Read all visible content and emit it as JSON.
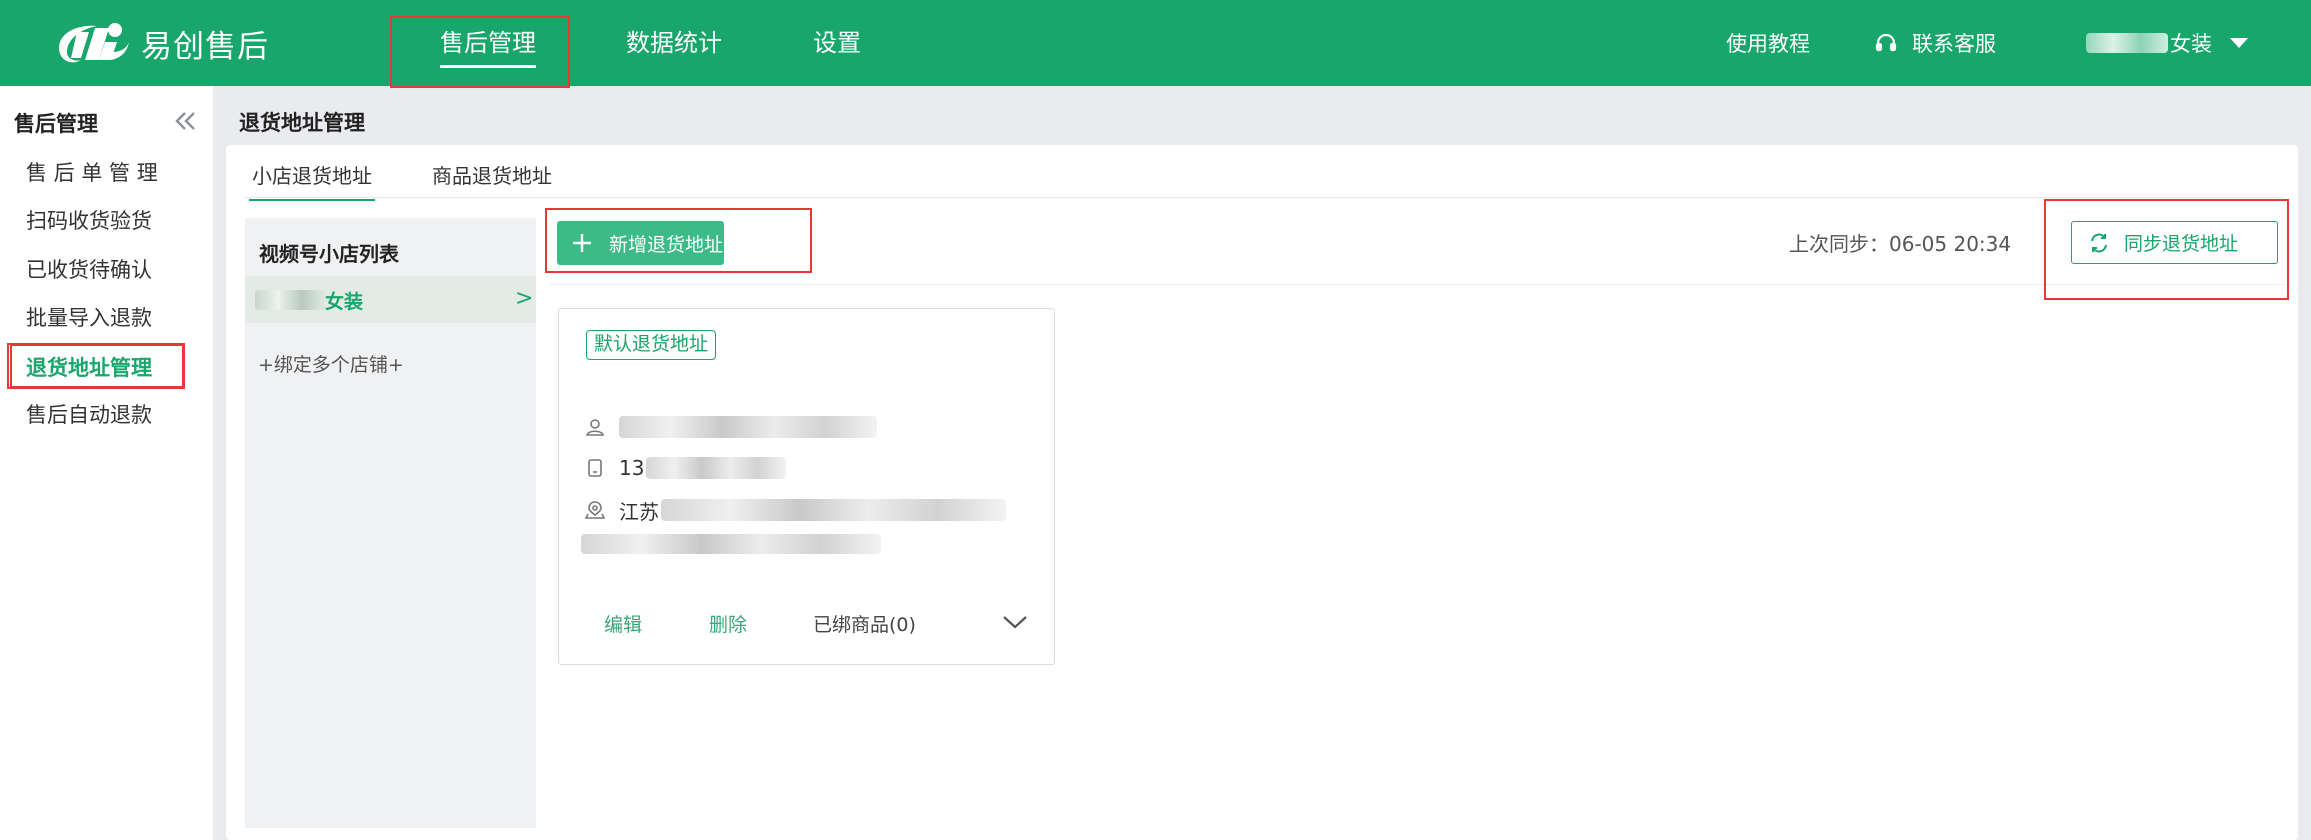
{
  "header": {
    "app_name": "易创售后",
    "nav": [
      {
        "label": "售后管理",
        "active": true
      },
      {
        "label": "数据统计",
        "active": false
      },
      {
        "label": "设置",
        "active": false
      }
    ],
    "tutorial_label": "使用教程",
    "support_label": "联系客服",
    "user_suffix": "女装",
    "brand_color": "#18a66b"
  },
  "sidebar": {
    "title": "售后管理",
    "items": [
      {
        "label": "售 后 单 管 理",
        "active": false
      },
      {
        "label": "扫码收货验货",
        "active": false
      },
      {
        "label": "已收货待确认",
        "active": false
      },
      {
        "label": "批量导入退款",
        "active": false
      },
      {
        "label": "退货地址管理",
        "active": true
      },
      {
        "label": "售后自动退款",
        "active": false
      }
    ]
  },
  "main": {
    "page_title": "退货地址管理",
    "tabs": [
      {
        "label": "小店退货地址",
        "active": true
      },
      {
        "label": "商品退货地址",
        "active": false
      }
    ],
    "shop_list": {
      "title": "视频号小店列表",
      "shops": [
        {
          "name_suffix": "女装",
          "selected": true
        }
      ],
      "bind_more_label": "+绑定多个店铺+"
    },
    "add_button_label": "新增退货地址",
    "last_sync_label": "上次同步：06-05 20:34",
    "sync_button_label": "同步退货地址",
    "address_card": {
      "tag": "默认退货地址",
      "phone_prefix": "13",
      "address_prefix": "江苏",
      "edit_label": "编辑",
      "delete_label": "删除",
      "bound_goods_label": "已绑商品(0)"
    }
  },
  "highlight_color": "#e53935"
}
